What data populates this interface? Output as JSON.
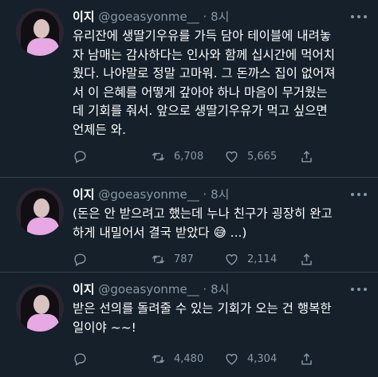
{
  "tweets": [
    {
      "name": "이지",
      "handle": "@goeasyonme__",
      "dot": "·",
      "time": "8시",
      "text": "유리잔에 생딸기우유를 가득 담아 테이블에 내려놓\n자 남매는 감사하다는 인사와 함께 십시간에 먹어치\n웠다. 나야말로 정말 고마워. 그 돈까스 집이 없어져\n서 이 은혜를 어떻게 갚아야 하나 마음이 무거웠는\n데 기회를 줘서. 앞으로 생딸기우유가 먹고 싶으면\n언제든 와.",
      "retweets": "6,708",
      "likes": "5,665"
    },
    {
      "name": "이지",
      "handle": "@goeasyonme__",
      "dot": "·",
      "time": "8시",
      "text": "(돈은 안 받으려고 했는데 누나 친구가 굉장히 완고\n하게 내밀어서 결국 받았다 😅 ...)",
      "retweets": "787",
      "likes": "2,114"
    },
    {
      "name": "이지",
      "handle": "@goeasyonme__",
      "dot": "·",
      "time": "8시",
      "text": "받은 선의를 돌려줄 수 있는 기회가 오는 건 행복한\n일이야 ~~!",
      "retweets": "4,480",
      "likes": "4,304"
    }
  ],
  "icons": {
    "reply": "reply-icon",
    "retweet": "retweet-icon",
    "like": "heart-icon",
    "share": "share-icon",
    "more": "more-icon"
  },
  "colors": {
    "background": "#15202b",
    "secondary_text": "#8899a6",
    "divider": "#38444d"
  }
}
